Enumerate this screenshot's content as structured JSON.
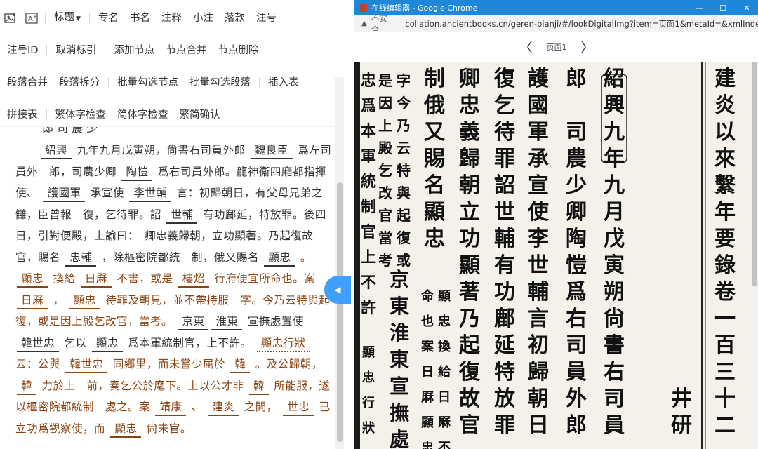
{
  "toolbar": {
    "row1": [
      "标题",
      "专名",
      "书名",
      "注释",
      "小注",
      "落款",
      "注号"
    ],
    "row2": [
      "注号ID",
      "取消标引",
      "添加节点",
      "节点合并",
      "节点删除"
    ],
    "row3": [
      "段落合并",
      "段落拆分",
      "批量勾选节点",
      "批量勾选段落",
      "插入表"
    ],
    "row4": [
      "拼接表",
      "繁体字检查",
      "简体字检查",
      "繁简确认"
    ]
  },
  "editor": {
    "partial_line": "郎 司 農 少",
    "p1": "紹興",
    "p2": " 九年九月戊寅朔，尙書右司員外郎 ",
    "p3": "魏良臣",
    "p4": " 爲左司員外　郎，司農少卿 ",
    "p5": "陶愷",
    "p6": " 爲右司員外郎。龍神衞四廂都指揮使、 ",
    "p7": "護國軍",
    "p8": " 承宣使 ",
    "p9": "李世輔",
    "p10": " 言：初歸朝日，有父母兄弟之讎，臣曾報　復，乞待罪。詔 ",
    "p11": "世輔",
    "p12": " 有功鄜延，特放罪。後四日，引對便殿，上諭曰：　卿忠義歸朝，立功顯著。乃起復故官，賜名 ",
    "p13": "忠輔",
    "p14": " ，除樞密院都統　制，俄又賜名 ",
    "p15": "顯忠",
    "p16": " 。 ",
    "p17": "顯忠",
    "p18": " 換給 ",
    "p19": "日厤",
    "p20": " 不書，或是 ",
    "p21": "樓炤",
    "p22": " 行府便宜所命也。案 ",
    "p23": "日厤",
    "p24": " ， ",
    "p25": "顯忠",
    "p26": " 待罪及朝見，並不帶持服　字。今乃云特與起復，或是因上殿乞改官，當考。 ",
    "p27": "京東",
    "p28": "淮東",
    "p29": " 宣撫處置使 ",
    "p30": "韓世忠",
    "p31": " 乞以 ",
    "p32": "顯忠",
    "p33": " 爲本軍統制官，上不許。 ",
    "p34": "顯忠行狀",
    "p35": " 云：公與 ",
    "p36": "韓世忠",
    "p37": " 同鄉里，而未嘗少屈於 ",
    "p38": "韓",
    "p39": " 。及公歸朝，　",
    "p40": "韓",
    "p41": " 力於上　前，奏乞公於麾下。上以公才非 ",
    "p42": "韓",
    "p43": " 所能服，遂以樞密院都統制　處之。案 ",
    "p44": "靖康",
    "p45": " 、 ",
    "p46": "建炎",
    "p47": " 之間， ",
    "p48": "世忠",
    "p49": " 已立功爲觀察使，而 ",
    "p50": "顯忠",
    "p51": " 尙未官。"
  },
  "chrome": {
    "window_title": "在线编辑器 - Google Chrome",
    "insecure_label": "不安全",
    "url": "collation.ancientbooks.cn/geren-bianji/#/lookDigitalImg?item=页面1&metaId=&xmlInde...",
    "page_label": "页面1"
  },
  "scan": {
    "columns": [
      "建炎以來繫年要錄卷一百三十二",
      "井研李",
      "紹興九年九月戊寅朔尙書右司員外郎魏",
      "郎　司農少卿陶愷爲右司員外郎　龍神",
      "護國軍承宣使李世輔言初歸朝日有父母",
      "復乞待罪詔世輔有功鄜延特放罪後四日",
      "卿忠義歸朝立功顯著乃起復故官賜名忠",
      "制俄又賜名顯忠",
      "顯忠換給日厤不書或是",
      "命也案日厤顯忠待罪及",
      "字今乃云特與起復或",
      "是因上殿乞改官當考",
      "京東淮東宣撫處",
      "忠爲本軍統制官上不許",
      "顯忠行狀云公與"
    ]
  },
  "colors": {
    "accent": "#409eff",
    "chrome_title": "#1e87d9",
    "tag_brown": "#8b4513"
  }
}
